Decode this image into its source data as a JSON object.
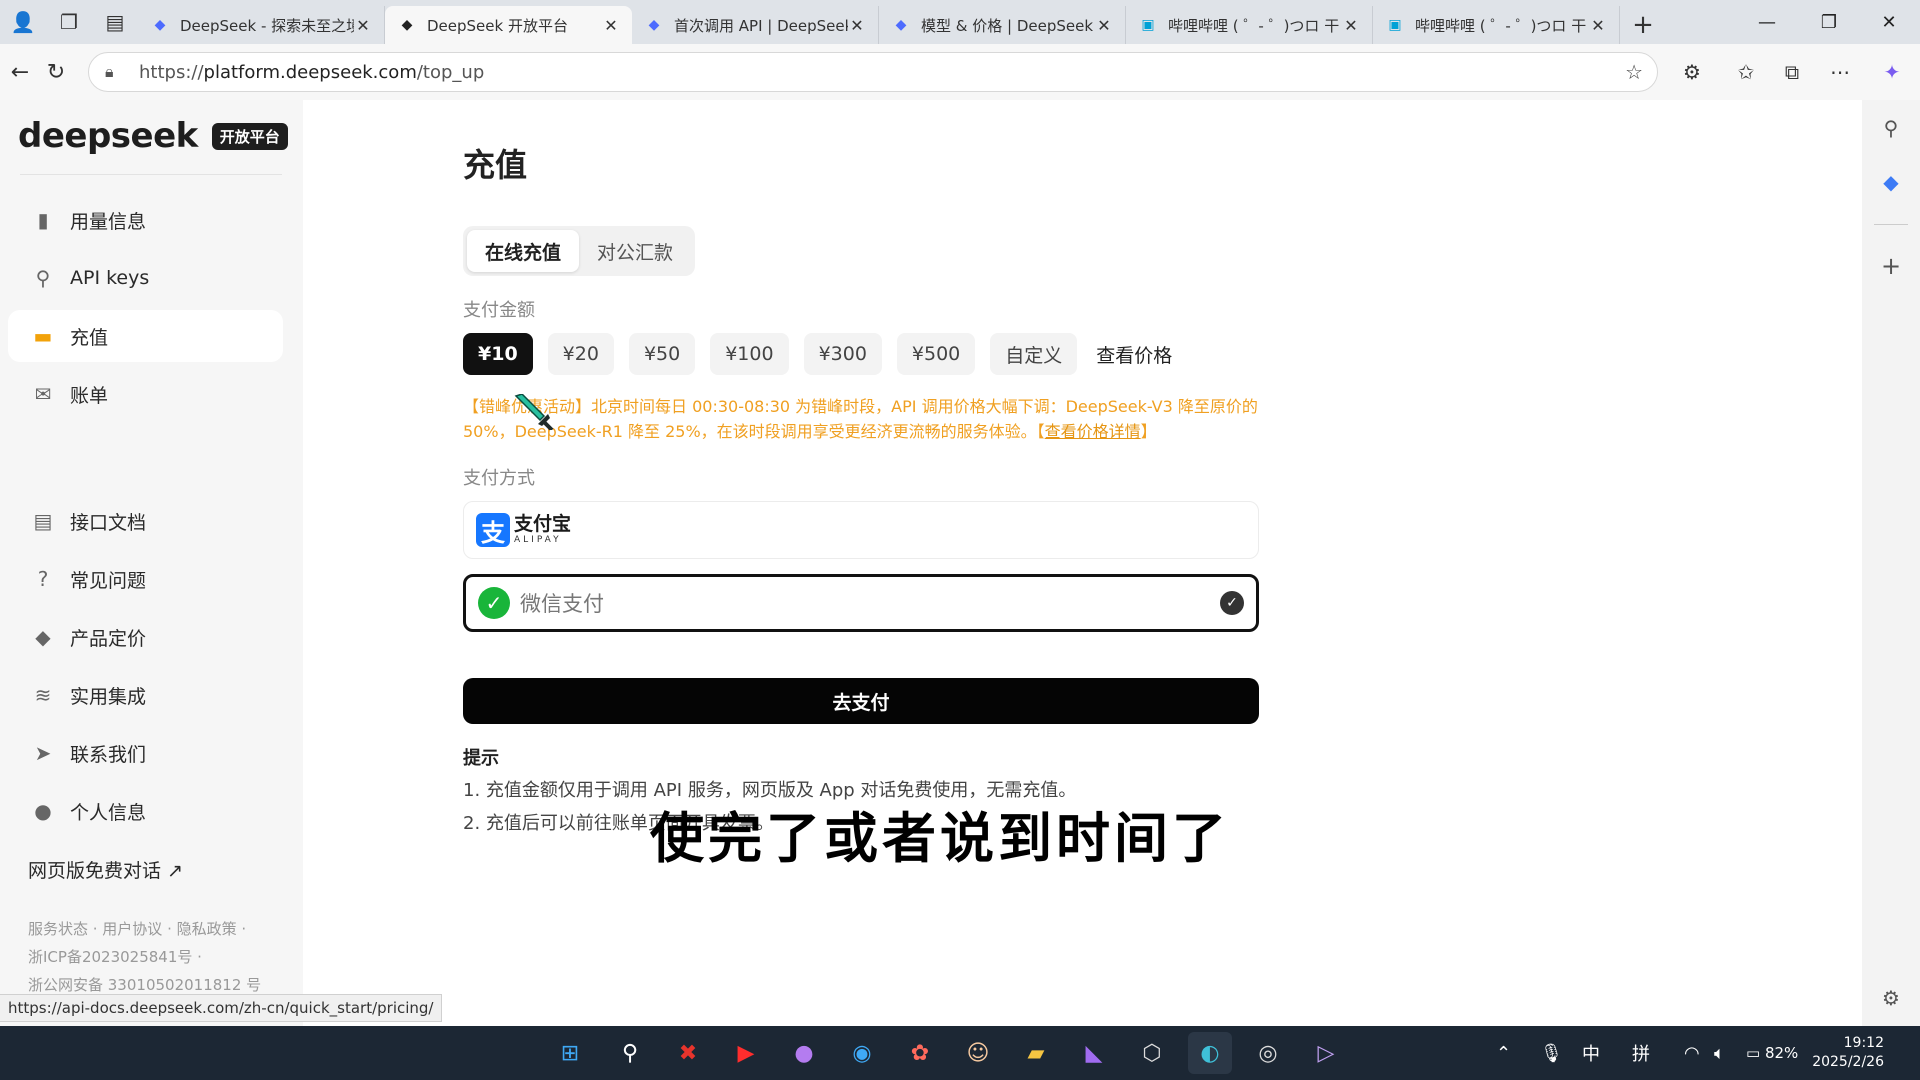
{
  "browser": {
    "tabs": [
      {
        "title": "DeepSeek - 探索未至之境",
        "icon": "deepseek-icon",
        "active": false
      },
      {
        "title": "DeepSeek 开放平台",
        "icon": "deepseek-icon",
        "active": true
      },
      {
        "title": "首次调用 API | DeepSeek",
        "icon": "deepseek-icon",
        "active": false
      },
      {
        "title": "模型 & 价格 | DeepSeek",
        "icon": "deepseek-icon",
        "active": false
      },
      {
        "title": "哔哩哔哩 ( ゜- ゜)つロ 干",
        "icon": "bilibili-icon",
        "active": false
      },
      {
        "title": "哔哩哔哩 ( ゜- ゜)つロ 干",
        "icon": "bilibili-icon",
        "active": false
      }
    ],
    "url": {
      "scheme": "https://",
      "host": "platform.deepseek.com",
      "path": "/top_up"
    },
    "status_url": "https://api-docs.deepseek.com/zh-cn/quick_start/pricing/"
  },
  "sidebar": {
    "logo_text": "deepseek",
    "logo_badge": "开放平台",
    "nav_top": [
      {
        "label": "用量信息",
        "icon": "bar-chart-icon",
        "active": false
      },
      {
        "label": "API keys",
        "icon": "search-icon",
        "active": false
      },
      {
        "label": "充值",
        "icon": "wallet-icon",
        "active": true
      },
      {
        "label": "账单",
        "icon": "bill-icon",
        "active": false
      }
    ],
    "nav_bottom": [
      {
        "label": "接口文档",
        "icon": "document-icon"
      },
      {
        "label": "常见问题",
        "icon": "question-icon"
      },
      {
        "label": "产品定价",
        "icon": "price-tag-icon"
      },
      {
        "label": "实用集成",
        "icon": "layers-icon"
      },
      {
        "label": "联系我们",
        "icon": "send-icon"
      },
      {
        "label": "个人信息",
        "icon": "user-icon"
      }
    ],
    "external_link": "网页版免费对话 ↗",
    "footer": {
      "links": "服务状态 · 用户协议 · 隐私政策 ·",
      "icp": "浙ICP备2023025841号 ·",
      "police": "浙公网安备 33010502011812 号"
    }
  },
  "main": {
    "title": "充值",
    "tabs": [
      "在线充值",
      "对公汇款"
    ],
    "amount_label": "支付金额",
    "amounts": [
      "¥10",
      "¥20",
      "¥50",
      "¥100",
      "¥300",
      "¥500",
      "自定义"
    ],
    "selected_amount_index": 0,
    "price_link": "查看价格",
    "notice": {
      "text": "【错峰优惠活动】北京时间每日 00:30-08:30 为错峰时段，API 调用价格大幅下调：DeepSeek-V3 降至原价的 50%，DeepSeek-R1 降至 25%，在该时段调用享受更经济更流畅的服务体验。【",
      "link": "查看价格详情",
      "end": "】"
    },
    "method_label": "支付方式",
    "alipay": {
      "cn": "支付宝",
      "en": "ALIPAY"
    },
    "wechat": "微信支付",
    "pay_button": "去支付",
    "tips_title": "提示",
    "tips": [
      "1. 充值金额仅用于调用 API 服务，网页版及 App 对话免费使用，无需充值。",
      "2. 充值后可以前往账单页面开具发票。"
    ]
  },
  "video_subtitle": "使完了或者说到时间了",
  "taskbar": {
    "tray_ime": "中",
    "tray_pinyin": "拼",
    "battery": "82%",
    "time": "19:12",
    "date": "2025/2/26"
  },
  "colors": {
    "accent": "#f2a20a",
    "notice": "#f0a022",
    "alipay": "#1677ff",
    "wechat": "#19b53a"
  }
}
